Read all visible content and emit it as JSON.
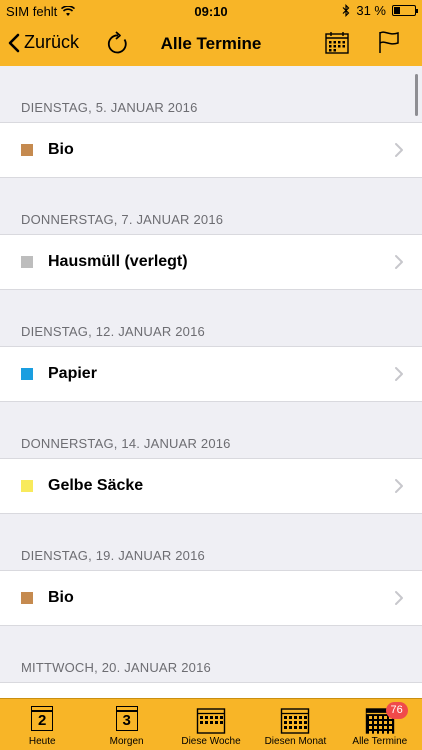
{
  "status": {
    "carrier": "SIM fehlt",
    "time": "09:10",
    "battery_text": "31 %",
    "battery_level": 0.31
  },
  "nav": {
    "back_label": "Zurück",
    "title": "Alle Termine"
  },
  "colors": {
    "accent": "#f8b527",
    "bio": "#c58a4f",
    "hausmuell": "#bdbdbd",
    "papier": "#1a9ee0",
    "gelbe_saecke": "#f8ea5c",
    "badge": "#f04a4a"
  },
  "sections": [
    {
      "date": "DIENSTAG, 5. JANUAR 2016",
      "item": "Bio",
      "color": "#c58a4f"
    },
    {
      "date": "DONNERSTAG, 7. JANUAR 2016",
      "item": "Hausmüll (verlegt)",
      "color": "#bdbdbd"
    },
    {
      "date": "DIENSTAG, 12. JANUAR 2016",
      "item": "Papier",
      "color": "#1a9ee0"
    },
    {
      "date": "DONNERSTAG, 14. JANUAR 2016",
      "item": "Gelbe Säcke",
      "color": "#f8ea5c"
    },
    {
      "date": "DIENSTAG, 19. JANUAR 2016",
      "item": "Bio",
      "color": "#c58a4f"
    },
    {
      "date": "MITTWOCH, 20. JANUAR 2016",
      "item": "",
      "color": "#bdbdbd"
    }
  ],
  "tabs": [
    {
      "label": "Heute",
      "icon": "day-2-icon",
      "icon_text": "2"
    },
    {
      "label": "Morgen",
      "icon": "day-3-icon",
      "icon_text": "3"
    },
    {
      "label": "Diese Woche",
      "icon": "week-calendar-icon"
    },
    {
      "label": "Diesen Monat",
      "icon": "month-calendar-icon"
    },
    {
      "label": "Alle Termine",
      "icon": "all-calendar-icon",
      "badge": "76",
      "active": true
    }
  ]
}
